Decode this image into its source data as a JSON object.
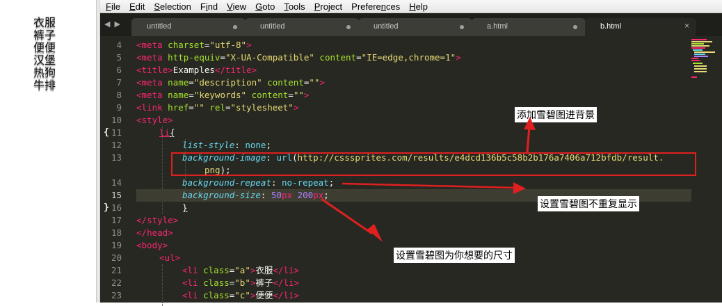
{
  "preview": {
    "items": [
      "衣服",
      "裤子",
      "便便",
      "汉堡",
      "热狗",
      "牛排"
    ]
  },
  "menu": [
    "File",
    "Edit",
    "Selection",
    "Find",
    "View",
    "Goto",
    "Tools",
    "Project",
    "Preferences",
    "Help"
  ],
  "menu_mnemonics": [
    "F",
    "E",
    "S",
    "i",
    "V",
    "G",
    "T",
    "P",
    "n",
    "H"
  ],
  "nav": {
    "back_icon": "◀",
    "forward_icon": "▶"
  },
  "tabs": [
    {
      "label": "untitled",
      "state": "modified"
    },
    {
      "label": "untitled",
      "state": "modified"
    },
    {
      "label": "untitled",
      "state": "modified"
    },
    {
      "label": "a.html",
      "state": "modified"
    },
    {
      "label": "b.html",
      "state": "active",
      "close": "×"
    }
  ],
  "gutter": {
    "line_numbers": [
      "4",
      "5",
      "6",
      "7",
      "8",
      "9",
      "10",
      "11",
      "12",
      "13",
      "",
      "14",
      "15",
      "16",
      "17",
      "18",
      "19",
      "20",
      "21",
      "22",
      "23"
    ],
    "fold_open": "{",
    "fold_close": "}"
  },
  "code": {
    "l4": {
      "t1": "<",
      "t2": "meta",
      "a1": " charset",
      "e": "=",
      "s1": "\"utf-8\"",
      "t3": ">"
    },
    "l5": {
      "t1": "<",
      "t2": "meta",
      "a1": " http-equiv",
      "e1": "=",
      "s1": "\"X-UA-Compatible\"",
      "a2": " content",
      "e2": "=",
      "s2": "\"IE=edge,chrome=1\"",
      "t3": ">"
    },
    "l6": {
      "t1": "<",
      "t2": "title",
      "t3": ">",
      "txt": "Examples",
      "t4": "</",
      "t5": "title",
      "t6": ">"
    },
    "l7": {
      "t1": "<",
      "t2": "meta",
      "a1": " name",
      "e1": "=",
      "s1": "\"description\"",
      "a2": " content",
      "e2": "=",
      "s2": "\"\"",
      "t3": ">"
    },
    "l8": {
      "t1": "<",
      "t2": "meta",
      "a1": " name",
      "e1": "=",
      "s1": "\"keywords\"",
      "a2": " content",
      "e2": "=",
      "s2": "\"\"",
      "t3": ">"
    },
    "l9": {
      "t1": "<",
      "t2": "link",
      "a1": " href",
      "e1": "=",
      "s1": "\"\"",
      "a2": " rel",
      "e2": "=",
      "s2": "\"stylesheet\"",
      "t3": ">"
    },
    "l10": {
      "t1": "<",
      "t2": "style",
      "t3": ">"
    },
    "l11": {
      "sel": "li",
      "br": "{"
    },
    "l12": {
      "prop": "list-style",
      "colon": ": ",
      "val": "none",
      "semi": ";"
    },
    "l13": {
      "prop": "background-image",
      "colon": ": ",
      "fn": "url",
      "p1": "(",
      "url": "http://csssprites.com/results/e4dcd136b5c58b2b176a7406a712bfdb/result."
    },
    "l13b": {
      "url": "png",
      "p2": ")",
      "semi": ";"
    },
    "l14": {
      "prop": "background-repeat",
      "colon": ": ",
      "val": "no-repeat",
      "semi": ";"
    },
    "l15": {
      "prop": "background-size",
      "colon": ": ",
      "n1": "50",
      "u1": "px",
      "sp": " ",
      "n2": "200",
      "u2": "px",
      "semi": ";"
    },
    "l16": {
      "br": "}"
    },
    "l17": {
      "t1": "</",
      "t2": "style",
      "t3": ">"
    },
    "l18": {
      "t1": "</",
      "t2": "head",
      "t3": ">"
    },
    "l19": {
      "t1": "<",
      "t2": "body",
      "t3": ">"
    },
    "l20": {
      "t1": "<",
      "t2": "ul",
      "t3": ">"
    },
    "l21": {
      "t1": "<",
      "t2": "li",
      "a1": " class",
      "e1": "=",
      "s1": "\"a\"",
      "t3": ">",
      "txt": "衣服",
      "t4": "</",
      "t5": "li",
      "t6": ">"
    },
    "l22": {
      "t1": "<",
      "t2": "li",
      "a1": " class",
      "e1": "=",
      "s1": "\"b\"",
      "t3": ">",
      "txt": "裤子",
      "t4": "</",
      "t5": "li",
      "t6": ">"
    },
    "l23": {
      "t1": "<",
      "t2": "li",
      "a1": " class",
      "e1": "=",
      "s1": "\"c\"",
      "t3": ">",
      "txt": "便便",
      "t4": "</",
      "t5": "li",
      "t6": ">"
    }
  },
  "annotations": {
    "add_sprite_bg": "添加雪碧图进背景",
    "no_repeat": "设置雪碧图不重复显示",
    "set_size": "设置雪碧图为你想要的尺寸"
  },
  "colors": {
    "editor_bg": "#272822",
    "tag": "#f92672",
    "attr": "#a6e22e",
    "string": "#e6db74",
    "property": "#66d9ef",
    "number": "#ae81ff",
    "annotation_red": "#e02020"
  }
}
